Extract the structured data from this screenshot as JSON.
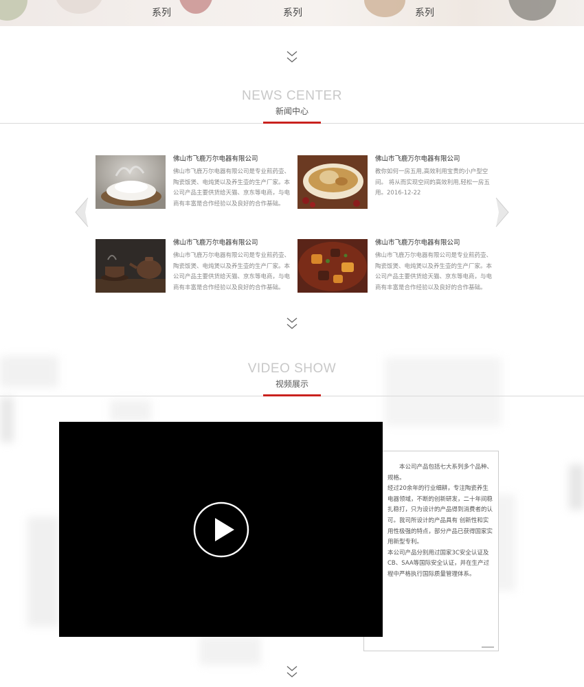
{
  "banner": {
    "series_labels": [
      "系列",
      "系列",
      "系列"
    ]
  },
  "news_section": {
    "title_en": "NEWS CENTER",
    "title_cn": "新闻中心",
    "items": [
      {
        "title": "佛山市飞鹿万尔电器有限公司",
        "desc": "佛山市飞鹿万尔电器有限公司是专业煎药壶、陶瓷饭煲、电炖煲以及养生壶的生产厂家。本公司产品主要供货给天猫、京东等电商，与电商有丰富是合作经验以及良好的合作基础。",
        "image": "steamed-rice-photo"
      },
      {
        "title": "佛山市飞鹿万尔电器有限公司",
        "desc": "教你如何一房五用,高效利用宝贵的小户型空间。 将从而实现空间的高效利用,轻松一房五用。2016-12-22",
        "image": "chicken-soup-photo"
      },
      {
        "title": "佛山市飞鹿万尔电器有限公司",
        "desc": "佛山市飞鹿万尔电器有限公司是专业煎药壶、陶瓷饭煲、电炖煲以及养生壶的生产厂家。本公司产品主要供货给天猫、京东等电商，与电商有丰富是合作经验以及良好的合作基础。",
        "image": "teapot-photo"
      },
      {
        "title": "佛山市飞鹿万尔电器有限公司",
        "desc": "佛山市飞鹿万尔电器有限公司是专业煎药壶、陶瓷饭煲、电炖煲以及养生壶的生产厂家。本公司产品主要供货给天猫、京东等电商，与电商有丰富是合作经验以及良好的合作基础。",
        "image": "braised-meat-photo"
      }
    ]
  },
  "video_section": {
    "title_en": "VIDEO SHOW",
    "title_cn": "视频展示",
    "info_paragraphs": [
      "　　本公司产品包括七大系列多个品种、规格。",
      "经过20余年的行业细耕，专注陶瓷养生电器领域，不断的创新研发，二十年间稳扎稳打，只为设计的产品得到消费者的认可。我司所设计的产品具有 创新性和实用性极强的特点，部分产品已获得国家实用新型专利。",
      "本公司产品分别用过国家3C安全认证及CB、SAA等国际安全认证，并在生产过程中严格执行国际质量管理体系。"
    ]
  },
  "colors": {
    "accent_red": "#c9211e",
    "title_gray": "#c8c8c8"
  }
}
